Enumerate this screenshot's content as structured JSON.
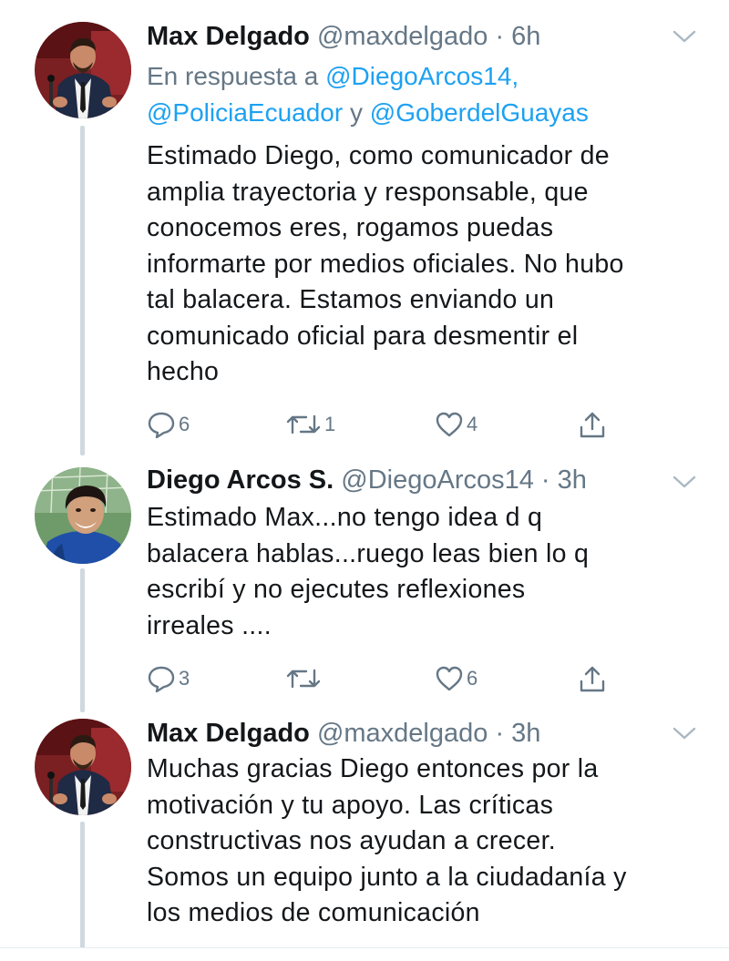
{
  "tweets": [
    {
      "name": "Max Delgado",
      "handle": "@maxdelgado",
      "time": "6h",
      "reply_prefix": "En respuesta a ",
      "reply_mention1": "@DiegoArcos14,",
      "reply_mention2": "@PoliciaEcuador",
      "reply_and": " y ",
      "reply_mention3": "@GoberdelGuayas",
      "lines": [
        "Estimado Diego, como comunicador de",
        "amplia trayectoria y responsable, que",
        "conocemos eres, rogamos puedas",
        "informarte por medios oficiales. No hubo",
        "tal balacera. Estamos enviando un",
        "comunicado oficial para desmentir el",
        "hecho"
      ],
      "replies": "6",
      "retweets": "1",
      "likes": "4",
      "avatar_icon": "man-at-podium-avatar"
    },
    {
      "name": "Diego Arcos S.",
      "handle": "@DiegoArcos14",
      "time": "3h",
      "lines": [
        "Estimado Max...no tengo idea d q",
        "balacera hablas...ruego leas bien lo q",
        "escribí y no ejecutes reflexiones",
        "irreales ...."
      ],
      "replies": "3",
      "retweets": "",
      "likes": "6",
      "avatar_icon": "smiling-man-avatar"
    },
    {
      "name": "Max Delgado",
      "handle": "@maxdelgado",
      "time": "3h",
      "lines": [
        "Muchas gracias Diego entonces por la",
        "motivación y tu apoyo. Las críticas",
        "constructivas nos ayudan a crecer.",
        "Somos un equipo junto a la ciudadanía y",
        "los medios de comunicación"
      ],
      "avatar_icon": "man-at-podium-avatar"
    }
  ],
  "separator": " · ",
  "colors": {
    "text": "#14171a",
    "secondary": "#657786",
    "link": "#1da1f2",
    "thread_line": "#cfd9de"
  },
  "icons": [
    "reply-icon",
    "retweet-icon",
    "like-icon",
    "share-icon",
    "chevron-down-icon"
  ]
}
